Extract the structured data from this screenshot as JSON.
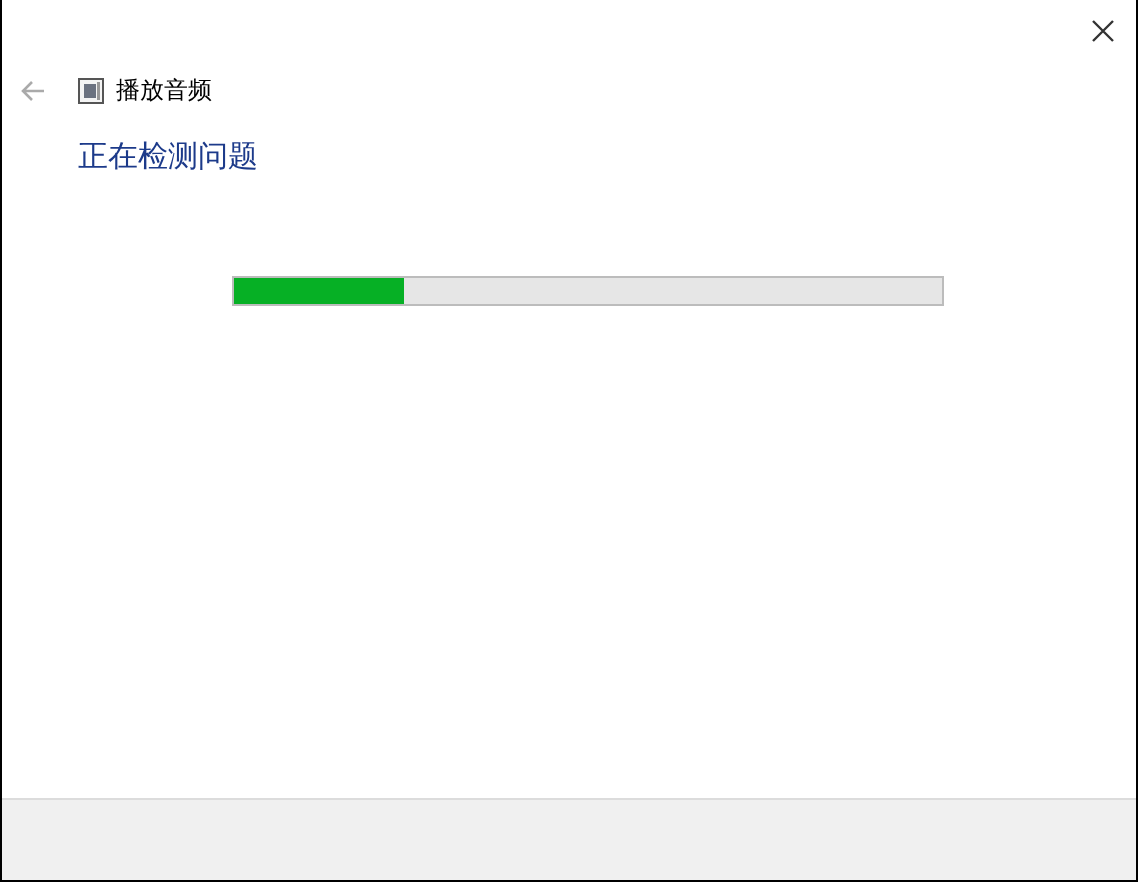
{
  "window": {
    "title": "播放音频"
  },
  "heading": "正在检测问题",
  "progress": {
    "level": 0.24
  }
}
